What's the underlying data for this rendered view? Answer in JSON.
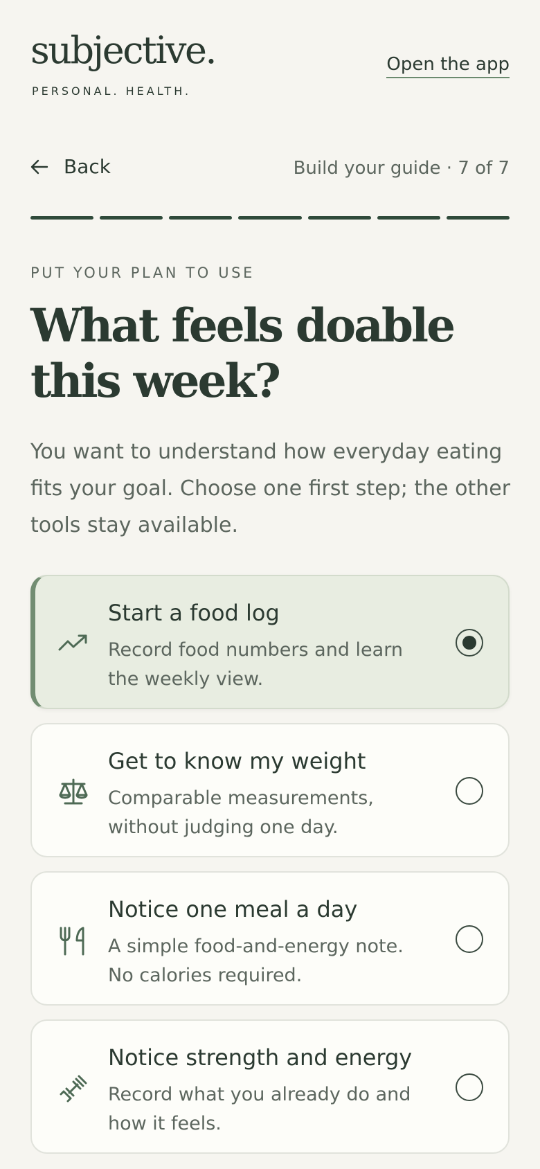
{
  "brand": {
    "logo": "subjective.",
    "tagline": "PERSONAL. HEALTH."
  },
  "header": {
    "open_app_label": "Open the app"
  },
  "nav": {
    "back_label": "Back",
    "step_text": "Build your guide · 7 of 7"
  },
  "progress": {
    "total_steps": 7,
    "current_step": 7
  },
  "content": {
    "eyebrow": "PUT YOUR PLAN TO USE",
    "title": "What feels doable this week?",
    "intro": "You want to understand how everyday eating fits your goal. Choose one first step; the other tools stay available."
  },
  "options": [
    {
      "icon": "trend-up-icon",
      "title": "Start a food log",
      "desc": "Record food numbers and learn the weekly view.",
      "selected": true
    },
    {
      "icon": "scale-icon",
      "title": "Get to know my weight",
      "desc": "Comparable measurements, without judging one day.",
      "selected": false
    },
    {
      "icon": "fork-knife-icon",
      "title": "Notice one meal a day",
      "desc": "A simple food-and-energy note. No calories required.",
      "selected": false
    },
    {
      "icon": "dumbbell-icon",
      "title": "Notice strength and energy",
      "desc": "Record what you already do and how it feels.",
      "selected": false
    }
  ],
  "colors": {
    "background": "#f6f5f0",
    "text": "#2b3a31",
    "muted": "#5c665e",
    "accent": "#728d72",
    "selected_bg": "#e8ede1"
  }
}
